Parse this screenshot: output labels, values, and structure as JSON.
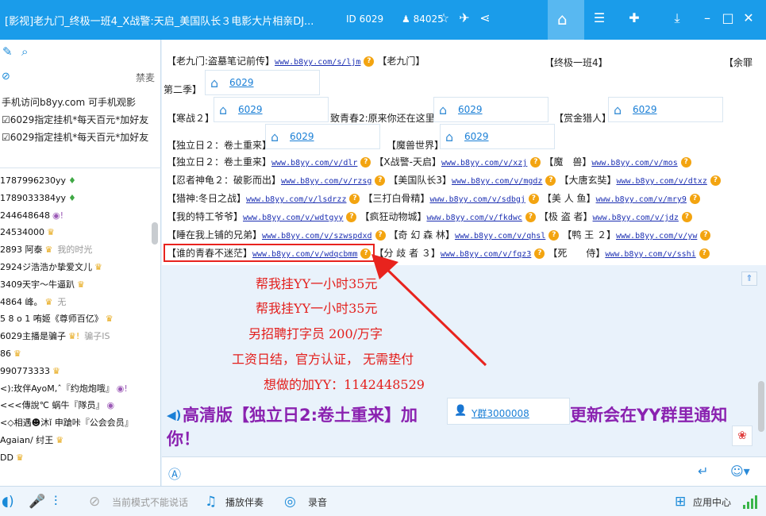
{
  "window": {
    "title": "[影视]老九门_终极一班4_X战警:天启_美国队长３电影大片相亲DJ...",
    "channel_id": "ID 6029",
    "user_count": "84025"
  },
  "left_panel": {
    "label_right": "禁麦",
    "notices": [
      "手机访问b8yy.com 可手机观影",
      "☑6029指定挂机*每天百元*加好友",
      "☑6029指定挂机*每天百元*加好友"
    ],
    "users": [
      {
        "name": "1787996230yy",
        "badge": "♦",
        "note": ""
      },
      {
        "name": "1789033384yy",
        "badge": "♦",
        "note": ""
      },
      {
        "name": "244648648",
        "badge": "◉!",
        "note": ""
      },
      {
        "name": "24534000",
        "badge": "♛",
        "note": ""
      },
      {
        "name": "2893      阿泰",
        "badge": "♛",
        "note": "我的时光"
      },
      {
        "name": "2924ジ浩浩か挚爱文儿",
        "badge": "♛",
        "note": ""
      },
      {
        "name": "3409天宇～牛逼趴",
        "badge": "♛",
        "note": ""
      },
      {
        "name": "4864   峰。",
        "badge": "♛",
        "note": "无"
      },
      {
        "name": "5 8 o 1  哊姬《尊师百亿》",
        "badge": "♛",
        "note": ""
      },
      {
        "name": "6029主播是骗子",
        "badge": "♛!",
        "note": "骗子IS"
      },
      {
        "name": "86",
        "badge": "♛",
        "note": ""
      },
      {
        "name": "990773333",
        "badge": "♛",
        "note": ""
      },
      {
        "name": "<):玫伴AyoM,ˆ『约炮炮哦』",
        "badge": "◉!",
        "note": ""
      },
      {
        "name": "<<<傳說℃   蜗牛『隊员』",
        "badge": "◉",
        "note": ""
      },
      {
        "name": "<◇相遇☻沐ǐ 申蹌咔『公会会员』",
        "badge": "",
        "note": ""
      },
      {
        "name": "Agaian/ 纣王",
        "badge": "♛",
        "note": ""
      },
      {
        "name": "DD",
        "badge": "♛",
        "note": ""
      }
    ]
  },
  "chat": {
    "line1": {
      "label": "【老九门:盗墓笔记前传】",
      "link": "www.b8yy.com/s/ljm",
      "label2": "【老九门】",
      "label3": "【终极一班4】",
      "label4": "【余罪"
    },
    "line2": {
      "label": "第二季】",
      "channel": "6029"
    },
    "line3": {
      "label1": "【寒战２】",
      "channel1": "6029",
      "label2": "致青春2:原来你还在这里",
      "channel2": "6029",
      "label3": "【赏金猎人】",
      "channel3": "6029"
    },
    "line4": {
      "label1": "【独立日２：卷土重来】",
      "channel1": "6029",
      "label2": "【魔兽世界】",
      "channel2": "6029"
    },
    "rows": [
      [
        {
          "t": "【独立日２：卷土重来】",
          "u": "www.b8yy.com/v/dlr"
        },
        {
          "t": "【X战警-天启】",
          "u": "www.b8yy.com/v/xzj"
        },
        {
          "t": "【魔　兽】",
          "u": "www.b8yy.com/v/mos"
        }
      ],
      [
        {
          "t": "【忍者神龟２：破影而出】",
          "u": "www.b8yy.com/v/rzsg"
        },
        {
          "t": "【美国队长3】",
          "u": "www.b8yy.com/v/mgdz"
        },
        {
          "t": "【大唐玄奘】",
          "u": "www.b8yy.com/v/dtxz"
        }
      ],
      [
        {
          "t": "【猎神:冬日之战】",
          "u": "www.b8yy.com/v/lsdrzz"
        },
        {
          "t": "【三打白骨精】",
          "u": "www.b8yy.com/v/sdbgj"
        },
        {
          "t": "【美 人 鱼】",
          "u": "www.b8yy.com/v/mry9"
        }
      ],
      [
        {
          "t": "【我的特工爷爷】",
          "u": "www.b8yy.com/v/wdtgyy"
        },
        {
          "t": "【疯狂动物城】",
          "u": "www.b8yy.com/v/fkdwc"
        },
        {
          "t": "【极 盗 者】",
          "u": "www.b8yy.com/v/jdz"
        }
      ],
      [
        {
          "t": "【睡在我上铺的兄弟】",
          "u": "www.b8yy.com/v/szwspdxd"
        },
        {
          "t": "【奇 幻 森 林】",
          "u": "www.b8yy.com/v/qhsl"
        },
        {
          "t": "【鸭 王 ２】",
          "u": "www.b8yy.com/v/yw"
        }
      ],
      [
        {
          "t": "【谁的青春不迷茫】",
          "u": "www.b8yy.com/v/wdqcbmm"
        },
        {
          "t": "【分 歧 者 ３】",
          "u": "www.b8yy.com/v/fqz3"
        },
        {
          "t": "【死　　侍】",
          "u": "www.b8yy.com/v/sshi"
        }
      ]
    ]
  },
  "ad_lines": [
    "帮我挂YY一小时35元",
    "帮我挂YY一小时35元",
    "另招聘打字员 200/万字",
    "工资日结，官方认证， 无需垫付",
    "想做的加YY：1142448529"
  ],
  "announcement": {
    "part1": "高清版【独立日2:卷土重来】加",
    "part2": "更新会在YY群里通知",
    "part3": "你！",
    "group_link": "Y群3000008"
  },
  "bottom_bar": {
    "mode_text": "当前模式不能说话",
    "accompany": "播放伴奏",
    "record": "录音",
    "app_center": "应用中心"
  },
  "colors": {
    "accent": "#1a9cea",
    "ad_red": "#e31f1c",
    "announce_purple": "#8a22b0"
  }
}
